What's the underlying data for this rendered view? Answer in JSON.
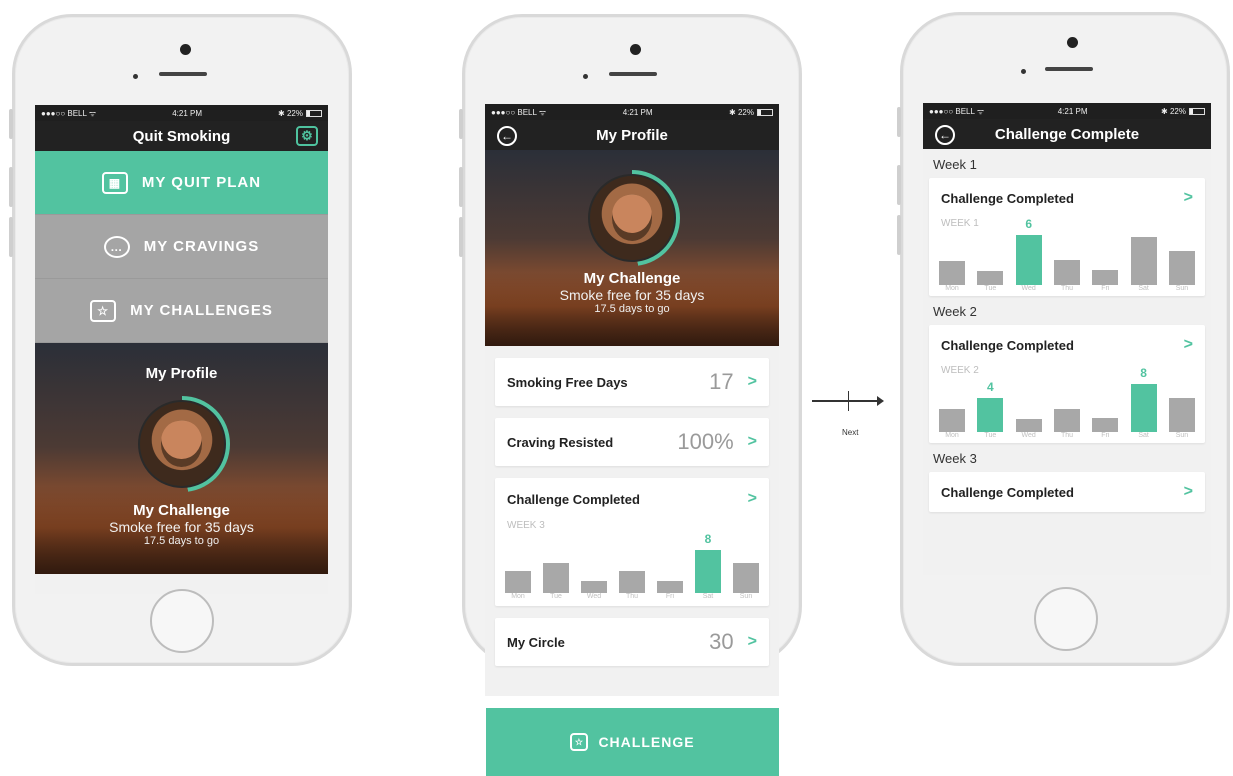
{
  "status": {
    "carrier": "●●●○○ BELL ᯤ",
    "time": "4:21 PM",
    "battery": "✱ 22%"
  },
  "screen1": {
    "title": "Quit Smoking",
    "menu": [
      {
        "label": "MY QUIT PLAN",
        "icon": "calendar-icon"
      },
      {
        "label": "MY CRAVINGS",
        "icon": "thought-bubble-icon"
      },
      {
        "label": "MY CHALLENGES",
        "icon": "shield-star-icon"
      }
    ],
    "profile_title": "My Profile",
    "challenge_title": "My Challenge",
    "challenge_sub": "Smoke free for 35 days",
    "challenge_small": "17.5 days to go"
  },
  "screen2": {
    "title": "My Profile",
    "challenge_title": "My Challenge",
    "challenge_sub": "Smoke free for 35 days",
    "challenge_small": "17.5 days to go",
    "rows": [
      {
        "label": "Smoking Free Days",
        "value": "17"
      },
      {
        "label": "Craving Resisted",
        "value": "100%"
      }
    ],
    "challenge_card": {
      "title": "Challenge Completed",
      "week": "WEEK 3",
      "highlight_label": "8",
      "days": [
        "Mon",
        "Tue",
        "Wed",
        "Thu",
        "Fri",
        "Sat",
        "Sun"
      ],
      "values": [
        0.45,
        0.62,
        0.25,
        0.45,
        0.25,
        0.9,
        0.62
      ],
      "highlight_index": 5
    },
    "circle_row": {
      "label": "My Circle",
      "value": "30"
    },
    "cta": "CHALLENGE"
  },
  "arrow_label": "Next",
  "screen3": {
    "title": "Challenge Complete",
    "weeks": [
      {
        "section": "Week 1",
        "title": "Challenge Completed",
        "week": "WEEK 1",
        "highlight_label": "6",
        "highlight_index": 2,
        "values": [
          0.48,
          0.28,
          1.0,
          0.5,
          0.3,
          0.95,
          0.68
        ]
      },
      {
        "section": "Week 2",
        "title": "Challenge Completed",
        "week": "WEEK 2",
        "highlight_label": "4",
        "highlight_index": 1,
        "second_label": "8",
        "second_index": 5,
        "values": [
          0.48,
          0.7,
          0.28,
          0.48,
          0.3,
          1.0,
          0.7
        ]
      }
    ],
    "days": [
      "Mon",
      "Tue",
      "Wed",
      "Thu",
      "Fri",
      "Sat",
      "Sun"
    ],
    "week3_section": "Week 3",
    "week3_title": "Challenge Completed"
  },
  "colors": {
    "accent": "#52c3a0",
    "grey_menu": "#a5a5a5",
    "nav": "#222222"
  }
}
